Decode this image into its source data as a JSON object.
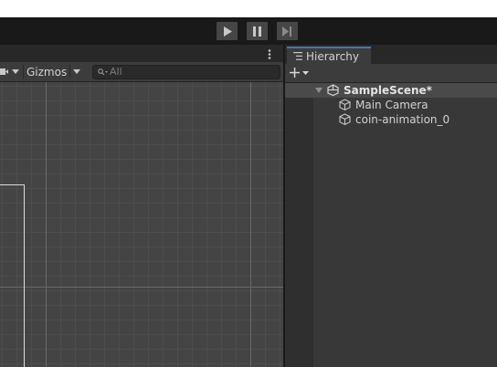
{
  "toolbar": {
    "play_icon": "play-icon",
    "pause_icon": "pause-icon",
    "step_icon": "step-icon"
  },
  "scene": {
    "gizmos_label": "Gizmos",
    "search_placeholder": "All",
    "colors": {
      "background": "#444444",
      "grid_line": "#4d4d4d",
      "axis_line": "#6a6a6a"
    }
  },
  "hierarchy": {
    "tab_label": "Hierarchy",
    "scene_name": "SampleScene*",
    "items": [
      {
        "label": "Main Camera"
      },
      {
        "label": "coin-animation_0"
      }
    ]
  }
}
